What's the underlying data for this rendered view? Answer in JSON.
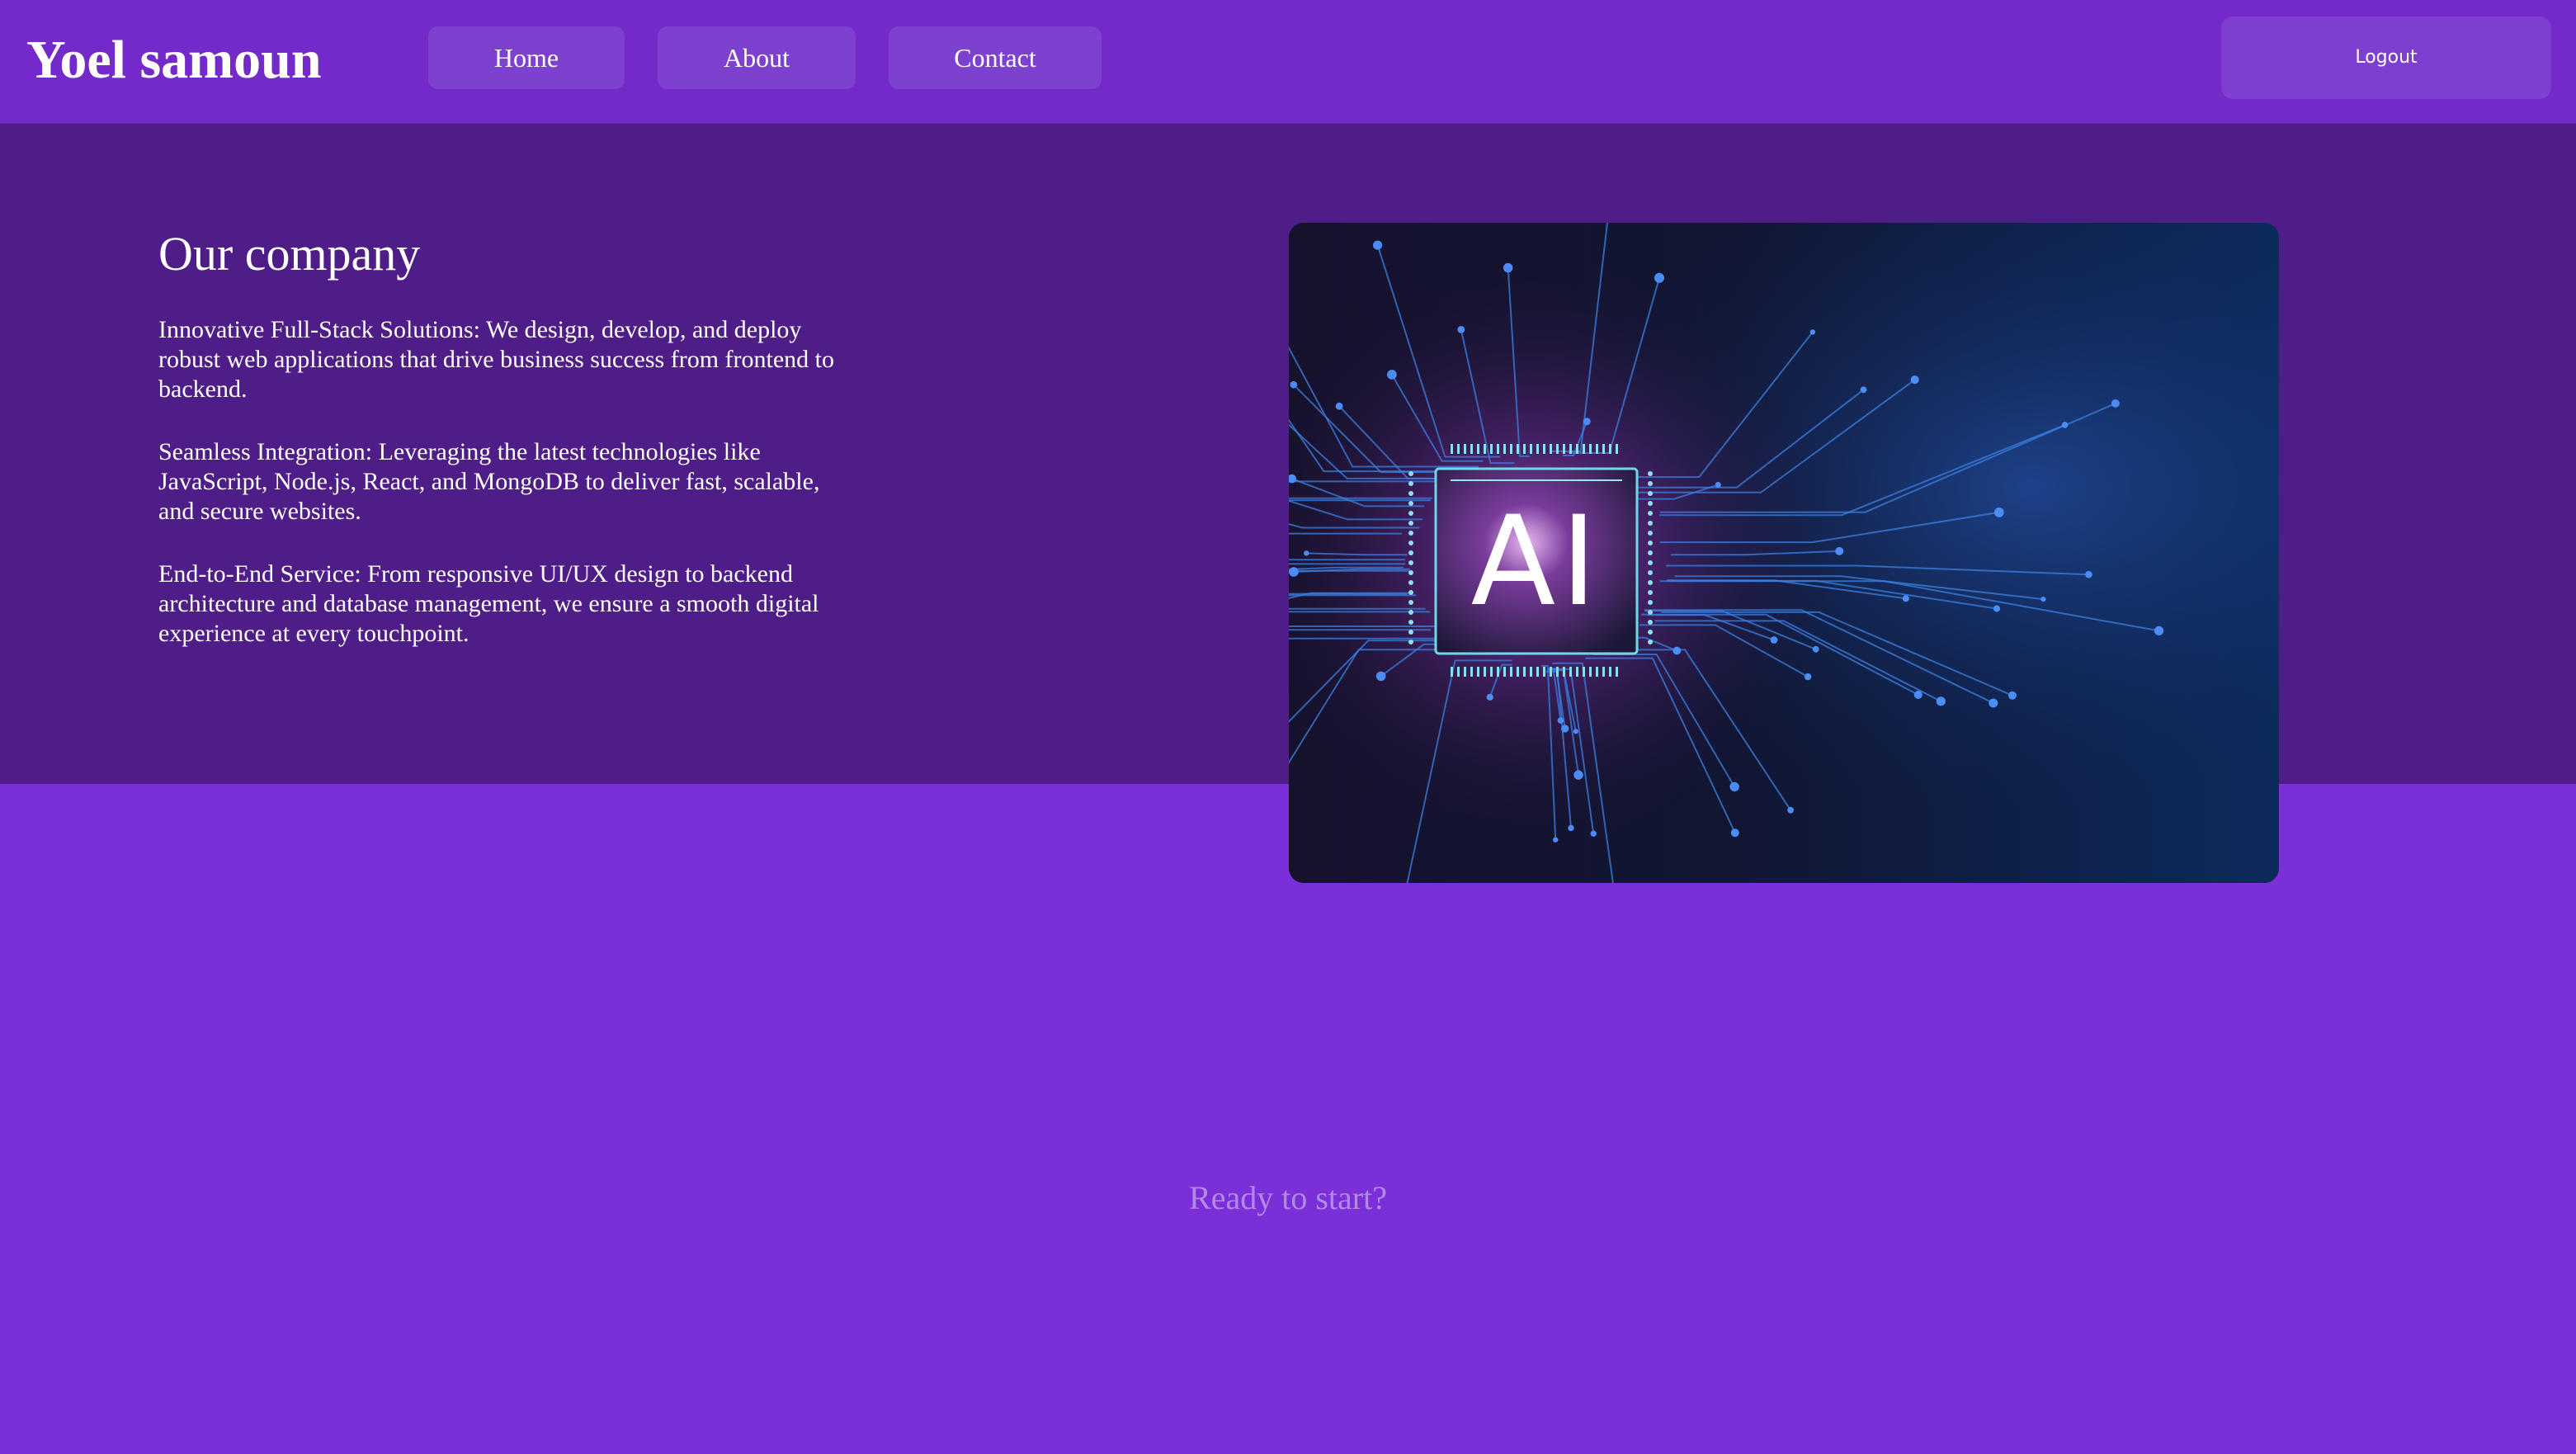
{
  "header": {
    "brand": "Yoel samoun",
    "nav": [
      {
        "label": "Home"
      },
      {
        "label": "About"
      },
      {
        "label": "Contact"
      }
    ],
    "logout_label": "Logout"
  },
  "hero": {
    "title": "Our company",
    "paragraphs": [
      "Innovative Full-Stack Solutions: We design, develop, and deploy robust web applications that drive business success from frontend to backend.",
      "Seamless Integration: Leveraging the latest technologies like JavaScript, Node.js, React, and MongoDB to deliver fast, scalable, and secure websites.",
      "End-to-End Service: From responsive UI/UX design to backend architecture and database management, we ensure a smooth digital experience at every touchpoint."
    ],
    "image": {
      "chip_text": "AI"
    }
  },
  "cta": {
    "text": "Ready to start?"
  },
  "colors": {
    "page_bg": "#7b2fd8",
    "header_bg": "#732ac9",
    "hero_bg": "#4e1d88",
    "button_bg": "#7d40cf",
    "cta_text": "#b18ae6"
  }
}
